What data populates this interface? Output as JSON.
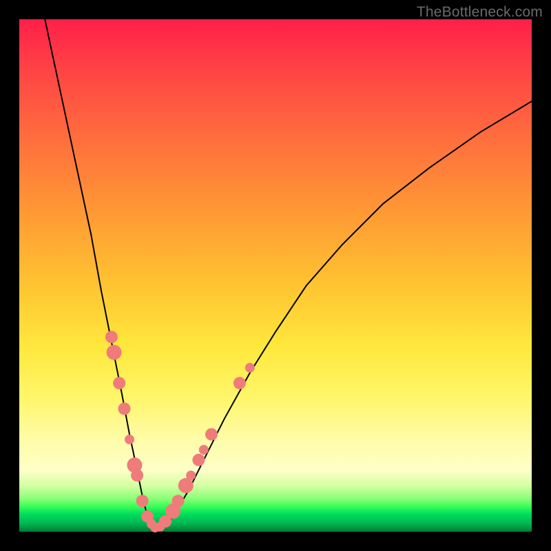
{
  "watermark": "TheBottleneck.com",
  "chart_data": {
    "type": "line",
    "title": "",
    "xlabel": "",
    "ylabel": "",
    "xlim": [
      0,
      100
    ],
    "ylim": [
      0,
      100
    ],
    "grid": false,
    "legend": false,
    "series": [
      {
        "name": "bottleneck-curve",
        "x": [
          5,
          8,
          11,
          14,
          16,
          18,
          20,
          21.5,
          23,
          24,
          25,
          26,
          27,
          28,
          30,
          33,
          36,
          40,
          45,
          50,
          56,
          63,
          71,
          80,
          90,
          100
        ],
        "y": [
          100,
          86,
          72,
          58,
          47,
          37,
          27,
          19,
          12,
          7,
          3,
          1,
          0.5,
          1,
          3,
          8,
          14,
          22,
          31,
          39,
          48,
          56,
          64,
          71,
          78,
          84
        ]
      }
    ],
    "points": [
      {
        "name": "p1",
        "x": 18.0,
        "y": 38,
        "size": "med"
      },
      {
        "name": "p2",
        "x": 18.5,
        "y": 35,
        "size": "big"
      },
      {
        "name": "p3",
        "x": 19.5,
        "y": 29,
        "size": "med"
      },
      {
        "name": "p4",
        "x": 20.5,
        "y": 24,
        "size": "med"
      },
      {
        "name": "p5",
        "x": 21.5,
        "y": 18,
        "size": "small"
      },
      {
        "name": "p6",
        "x": 22.5,
        "y": 13,
        "size": "big"
      },
      {
        "name": "p7",
        "x": 23.0,
        "y": 11,
        "size": "med"
      },
      {
        "name": "p8",
        "x": 24.0,
        "y": 6,
        "size": "med"
      },
      {
        "name": "p9",
        "x": 25.0,
        "y": 3,
        "size": "med"
      },
      {
        "name": "p10",
        "x": 25.8,
        "y": 1.5,
        "size": "small"
      },
      {
        "name": "p11",
        "x": 26.5,
        "y": 0.8,
        "size": "small"
      },
      {
        "name": "p12",
        "x": 27.5,
        "y": 1.0,
        "size": "small"
      },
      {
        "name": "p13",
        "x": 28.5,
        "y": 2.0,
        "size": "med"
      },
      {
        "name": "p14",
        "x": 30.0,
        "y": 4.0,
        "size": "big"
      },
      {
        "name": "p15",
        "x": 31.0,
        "y": 6.0,
        "size": "med"
      },
      {
        "name": "p16",
        "x": 32.5,
        "y": 9.0,
        "size": "big"
      },
      {
        "name": "p17",
        "x": 33.5,
        "y": 11,
        "size": "small"
      },
      {
        "name": "p18",
        "x": 35.0,
        "y": 14,
        "size": "med"
      },
      {
        "name": "p19",
        "x": 36.0,
        "y": 16,
        "size": "small"
      },
      {
        "name": "p20",
        "x": 37.5,
        "y": 19,
        "size": "med"
      },
      {
        "name": "p21",
        "x": 43.0,
        "y": 29,
        "size": "med"
      },
      {
        "name": "p22",
        "x": 45.0,
        "y": 32,
        "size": "small"
      }
    ],
    "background_gradient": {
      "top": "#ff1f49",
      "mid": "#ffe83d",
      "bottom_band": "#00e05a"
    }
  }
}
